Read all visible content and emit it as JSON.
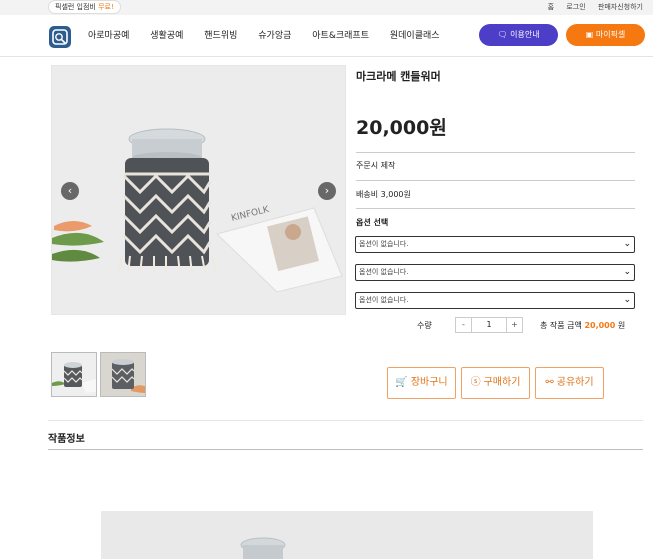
{
  "topbar": {
    "promo_prefix": "픽셀런 입점비 ",
    "promo_highlight": "무료!",
    "links": [
      "홈",
      "로그인",
      "판매자신청하기"
    ]
  },
  "header": {
    "nav": [
      "아로마공예",
      "생활공예",
      "핸드위빙",
      "슈가앙금",
      "아트&크래프트",
      "원데이클래스"
    ],
    "info_button": "이용안내",
    "mypage_button": "마이픽셀"
  },
  "product": {
    "title": "마크라메 캔들워머",
    "price": "20,000원",
    "made_to_order": "주문시 제작",
    "shipping": "배송비 3,000원",
    "option_label": "옵션 선택",
    "options": [
      "옵션이 없습니다.",
      "옵션이 없습니다.",
      "옵션이 없습니다."
    ],
    "quantity_label": "수량",
    "quantity": "1",
    "minus": "-",
    "plus": "+",
    "total_label": "총 작품 금액",
    "total_amount": "20,000",
    "total_unit": "원",
    "image_count": 2
  },
  "actions": {
    "cart": "장바구니",
    "buy": "구매하기",
    "share": "공유하기"
  },
  "section": {
    "title": "작품정보"
  },
  "colors": {
    "primary_purple": "#4c3ec7",
    "accent_orange": "#f57811",
    "action_border": "#f3a162"
  }
}
